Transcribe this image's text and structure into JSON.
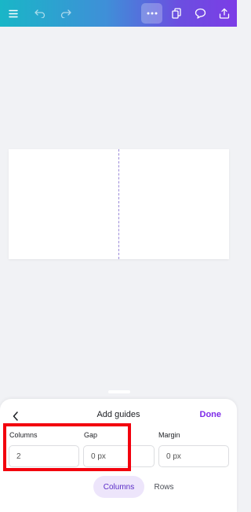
{
  "toolbar": {
    "icons": [
      "menu-icon",
      "undo-icon",
      "redo-icon",
      "more-icon",
      "pages-icon",
      "comment-icon",
      "share-icon"
    ]
  },
  "sheet": {
    "title": "Add guides",
    "done_label": "Done",
    "columns": {
      "label": "Columns",
      "value": "2"
    },
    "gap": {
      "label": "Gap",
      "value": "0 px"
    },
    "margin": {
      "label": "Margin",
      "value": "0 px"
    },
    "tabs": [
      {
        "label": "Columns",
        "active": true
      },
      {
        "label": "Rows",
        "active": false
      }
    ]
  },
  "colors": {
    "accent": "#7d2ae8",
    "highlight": "#f2000d",
    "guide": "#9c8bd9"
  }
}
